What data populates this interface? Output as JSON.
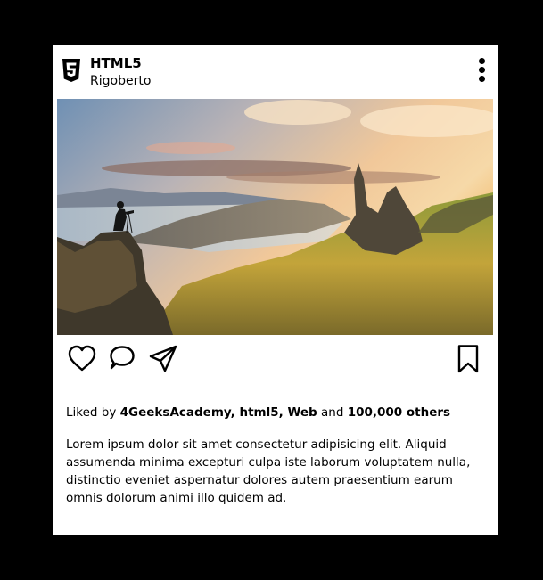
{
  "post": {
    "account": {
      "name": "HTML5",
      "subtitle": "Rigoberto",
      "logo_icon": "html5-logo-icon"
    },
    "menu_icon": "more-vertical-icon",
    "photo_description_icon": "landscape-photo",
    "actions": [
      {
        "icon": "heart-icon"
      },
      {
        "icon": "comment-icon"
      },
      {
        "icon": "send-icon"
      },
      {
        "icon": "bookmark-icon"
      }
    ],
    "likes": {
      "prefix": "Liked by",
      "users": "4GeeksAcademy, html5, Web",
      "conjunction": "and",
      "others": "100,000 others"
    },
    "caption": "Lorem ipsum dolor sit amet consectetur adipisicing elit. Aliquid assumenda minima excepturi culpa iste laborum voluptatem nulla, distinctio eveniet aspernatur dolores autem praesentium earum omnis dolorum animi illo quidem ad."
  },
  "colors": {
    "background": "#000000",
    "card": "#ffffff",
    "text": "#000000"
  }
}
